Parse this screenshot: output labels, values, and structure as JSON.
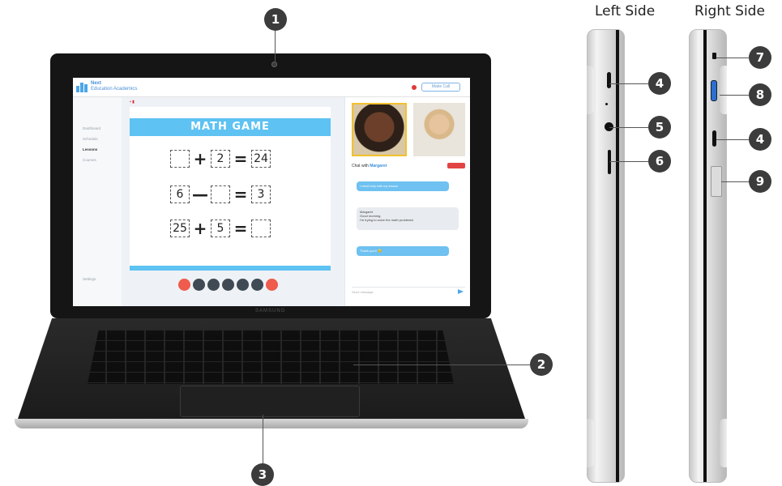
{
  "side_labels": {
    "left": "Left Side",
    "right": "Right Side"
  },
  "callouts": [
    "1",
    "2",
    "3",
    "4",
    "5",
    "6",
    "7",
    "8",
    "9",
    "4"
  ],
  "screen": {
    "brand_title_line1": "Next",
    "brand_title_line2": "Education Academics",
    "header_button": "Make Call",
    "nav_items": [
      "Dashboard",
      "Schedule",
      "Lessons",
      "Courses"
    ],
    "nav_active": "Lessons",
    "nav_bottom": "Settings",
    "game_title": "MATH GAME",
    "equations": [
      {
        "a": "",
        "op": "+",
        "b": "2",
        "eq": "=",
        "c": "24"
      },
      {
        "a": "6",
        "op": "—",
        "b": "",
        "eq": "=",
        "c": "3"
      },
      {
        "a": "25",
        "op": "+",
        "b": "5",
        "eq": "=",
        "c": ""
      }
    ],
    "chat_label_prefix": "Chat with",
    "chat_label_name": "Margaret",
    "chat_messages": [
      "I need help with my lesson",
      "Margaret\nGood morning.\nI'm trying to solve the math problems!",
      "Thank you!! 😊"
    ],
    "chat_placeholder": "Send message"
  },
  "laptop_brand": "SAMSUNG",
  "colors": {
    "callout_bg": "#3c3c3c",
    "game_accent": "#5ec2f2",
    "control_red": "#ef5b4c"
  }
}
